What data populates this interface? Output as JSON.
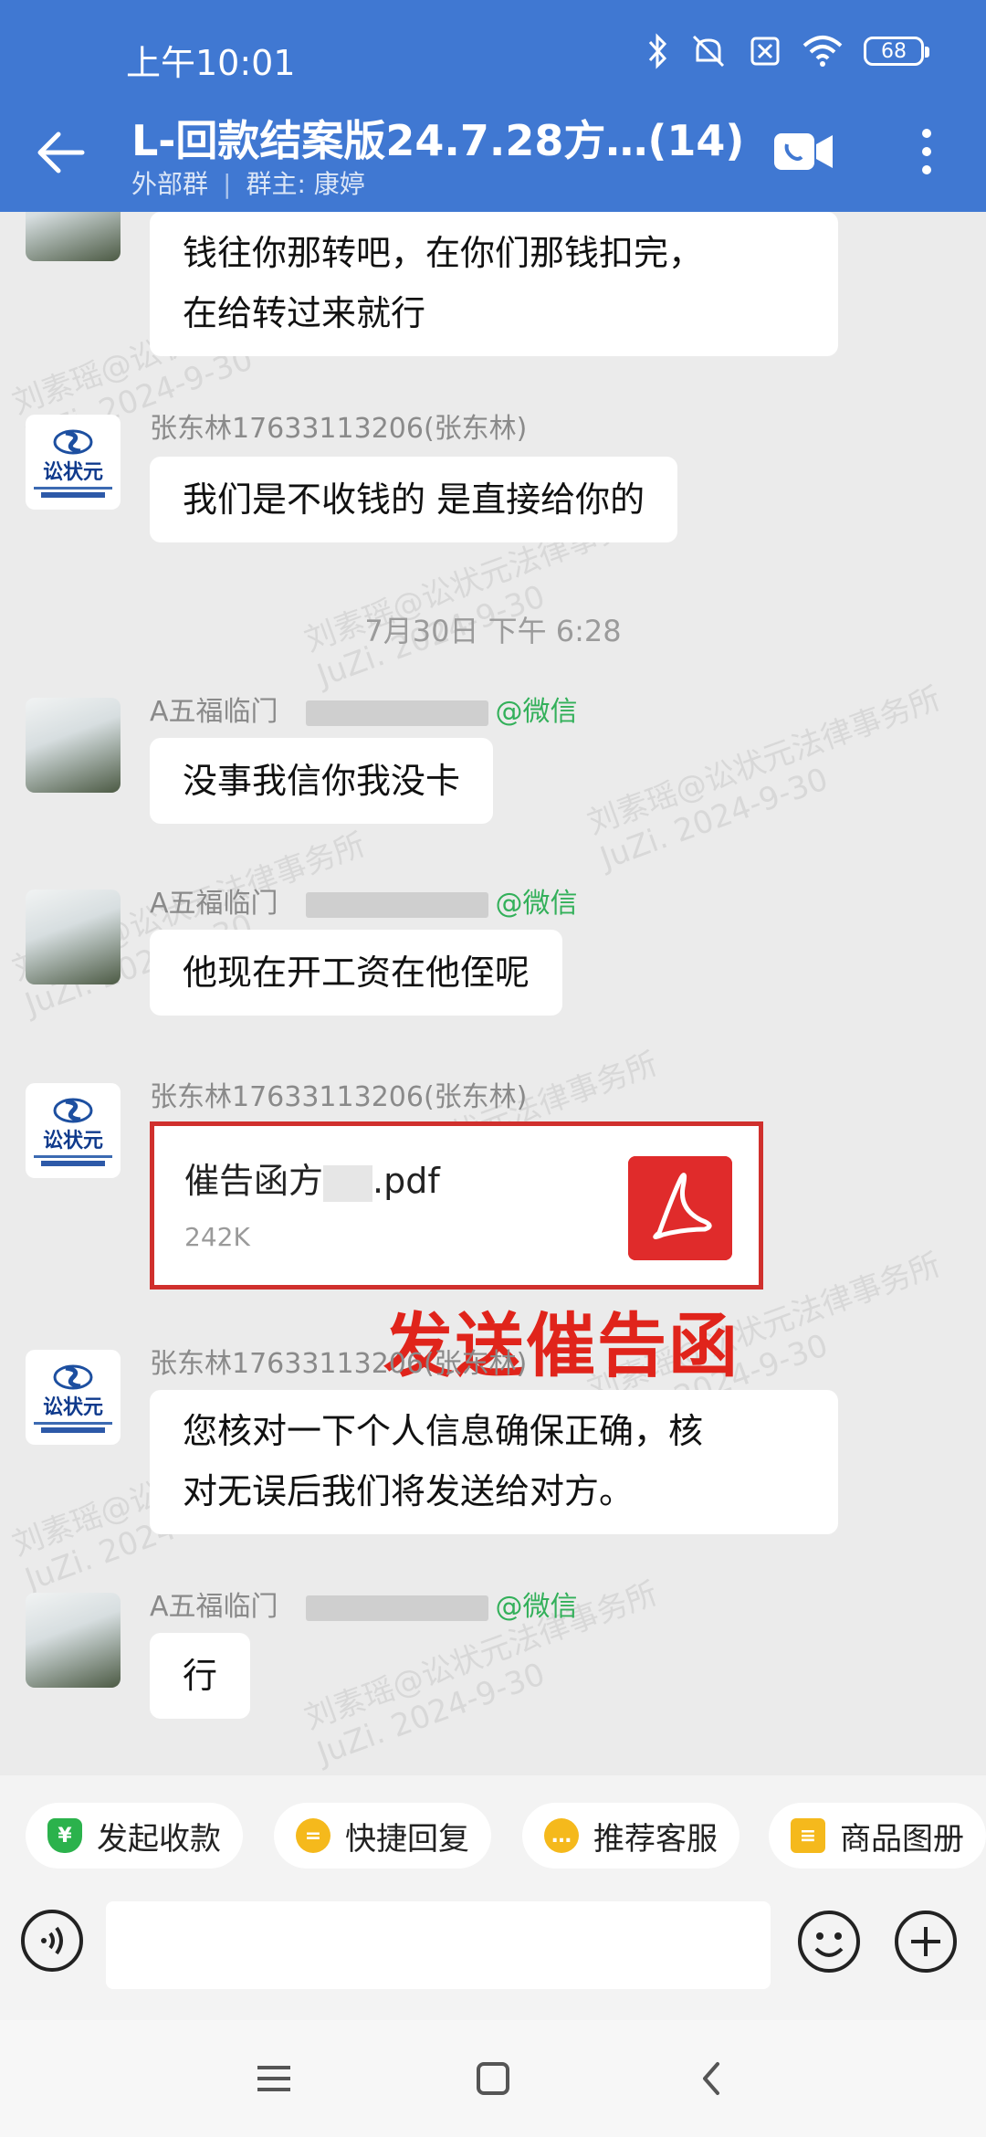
{
  "status_bar": {
    "time": "上午10:01",
    "battery": "68",
    "icons": [
      "bluetooth-icon",
      "mute-icon",
      "sim-off-icon",
      "wifi-icon",
      "battery-icon"
    ]
  },
  "header": {
    "title": "L-回款结案版24.7.28方…(14)",
    "group_type": "外部群",
    "owner": "群主: 康婷",
    "icons": [
      "back-arrow-icon",
      "video-call-icon",
      "more-vertical-icon"
    ],
    "background": "#4078d2"
  },
  "watermark": {
    "line1": "刘素瑶@讼状元法律事务所",
    "line2": "JuZi. 2024-9-30"
  },
  "messages": [
    {
      "sender": "",
      "text_lines": [
        "钱往你那转吧，在你们那钱扣完，",
        "在给转过来就行"
      ]
    },
    {
      "sender": "张东林17633113206(张东林)",
      "text_lines": [
        "我们是不收钱的 是直接给你的"
      ]
    },
    {
      "divider": "7月30日  下午 6:28"
    },
    {
      "sender": "A五福临门",
      "tag": "@微信",
      "text_lines": [
        "没事我信你我没卡"
      ]
    },
    {
      "sender": "A五福临门",
      "tag": "@微信",
      "text_lines": [
        "他现在开工资在他侄呢"
      ]
    },
    {
      "sender": "张东林17633113206(张东林)",
      "file": {
        "name": "催告函方",
        "ext": ".pdf",
        "size": "242K"
      }
    },
    {
      "sender": "张东林17633113206(张东林)",
      "text_lines": [
        "您核对一下个人信息确保正确，核",
        "对无误后我们将发送给对方。"
      ]
    },
    {
      "sender": "A五福临门",
      "tag": "@微信",
      "text_lines": [
        "行"
      ]
    }
  ],
  "logo_avatar": {
    "text": "讼状元"
  },
  "annotation": {
    "text": "发送催告函",
    "color": "#e0241b"
  },
  "quick_actions": [
    {
      "label": "发起收款",
      "icon": "payment-shield-icon",
      "color": "#2bb24c"
    },
    {
      "label": "快捷回复",
      "icon": "quick-reply-icon",
      "color": "#f5b91c"
    },
    {
      "label": "推荐客服",
      "icon": "service-icon",
      "color": "#f5b91c"
    },
    {
      "label": "商品图册",
      "icon": "catalog-icon",
      "color": "#f5b91c"
    }
  ],
  "input": {
    "placeholder": ""
  }
}
